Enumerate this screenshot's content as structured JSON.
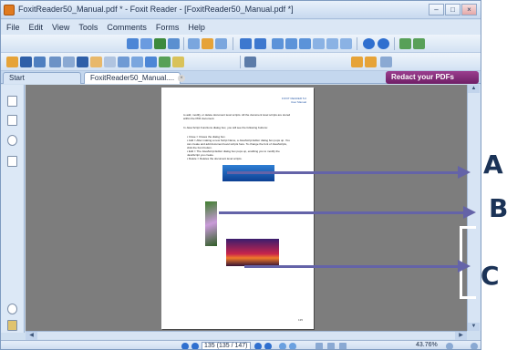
{
  "window": {
    "title": "FoxitReader50_Manual.pdf * - Foxit Reader - [FoxitReader50_Manual.pdf *]",
    "controls": {
      "minimize": "–",
      "maximize": "□",
      "close": "×"
    }
  },
  "menu": {
    "items": [
      "File",
      "Edit",
      "View",
      "Tools",
      "Comments",
      "Forms",
      "Help"
    ]
  },
  "tabs": {
    "start": "Start",
    "doc": "FoxitReader50_Manual....",
    "close_glyph": "×",
    "redact": "Redact your PDFs"
  },
  "document": {
    "header": [
      "FOXIT READER 5.0",
      "User Manual"
    ],
    "intro": "to add, modify, or delete document level scripts. All the document level scripts are stored within the PDF document.",
    "para2": "In Java Script Functions dialog box, you will see the following buttons:",
    "bullets": [
      "Close = Closes the dialog box.",
      "Add = After making a new Script Name, a JavaScript Editor dialog box pops up. You can create and add document level scripts here. To change the font of JavaScripts, click the Font button.",
      "Edit = The JavaScript Editor dialog box pops up, enabling you to modify the JavaScript you create.",
      "Delete = Deletes the document level scripts."
    ],
    "page_number": "135"
  },
  "status": {
    "page_field": "135 (135 / 147)",
    "zoom": "43.76%"
  },
  "annotations": {
    "labels": [
      "A",
      "B",
      "C"
    ],
    "color": "#6463a8"
  }
}
